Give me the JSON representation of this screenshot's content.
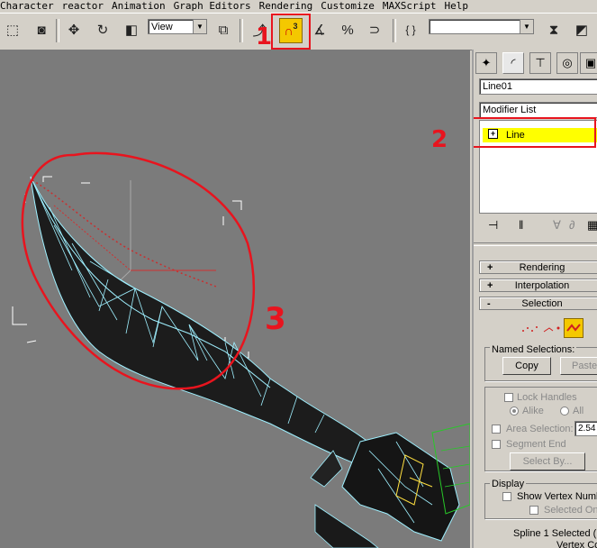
{
  "menu": [
    "Character",
    "reactor",
    "Animation",
    "Graph Editors",
    "Rendering",
    "Customize",
    "MAXScript",
    "Help"
  ],
  "toolbar": {
    "view_dropdown": "View",
    "snap_label": "3"
  },
  "panel": {
    "object_name": "Line01",
    "modifier_list_label": "Modifier List",
    "stack_item": "Line",
    "stack_item_expander": "+",
    "rollouts": {
      "rendering": {
        "sign": "+",
        "label": "Rendering"
      },
      "interpolation": {
        "sign": "+",
        "label": "Interpolation"
      },
      "selection": {
        "sign": "-",
        "label": "Selection"
      }
    },
    "named_selections_label": "Named Selections:",
    "copy_label": "Copy",
    "paste_label": "Paste",
    "lock_handles_label": "Lock Handles",
    "alike_label": "Alike",
    "all_label": "All",
    "area_selection_label": "Area Selection:",
    "area_selection_value": "2.54",
    "segment_end_label": "Segment End",
    "select_by_label": "Select By...",
    "display_label": "Display",
    "show_vertex_numbers_label": "Show Vertex Numb",
    "selected_only_label": "Selected On",
    "status_line1": "Spline 1 Selected (",
    "status_line2": "Vertex Co"
  },
  "annotations": [
    "1",
    "2",
    "3"
  ],
  "colors": {
    "accent_yellow": "#f4c800",
    "annotation_red": "#e8141e",
    "viewport_bg": "#7b7b7b",
    "wire_cyan": "#9ff0ff"
  }
}
